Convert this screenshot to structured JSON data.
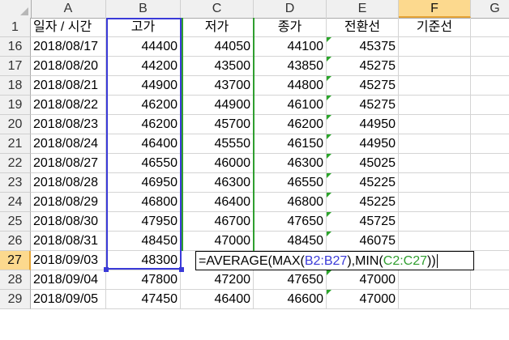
{
  "columns": [
    "A",
    "B",
    "C",
    "D",
    "E",
    "F",
    "G"
  ],
  "header_row": {
    "row": "1",
    "cells": [
      "일자 / 시간",
      "고가",
      "저가",
      "종가",
      "전환선",
      "기준선"
    ]
  },
  "rows": [
    {
      "row": "16",
      "date": "2018/08/17",
      "high": "44400",
      "low": "44050",
      "close": "44100",
      "conv": "45375"
    },
    {
      "row": "17",
      "date": "2018/08/20",
      "high": "44200",
      "low": "43500",
      "close": "43850",
      "conv": "45275"
    },
    {
      "row": "18",
      "date": "2018/08/21",
      "high": "44900",
      "low": "43700",
      "close": "44800",
      "conv": "45275"
    },
    {
      "row": "19",
      "date": "2018/08/22",
      "high": "46200",
      "low": "44900",
      "close": "46100",
      "conv": "45275"
    },
    {
      "row": "20",
      "date": "2018/08/23",
      "high": "46200",
      "low": "45700",
      "close": "46200",
      "conv": "44950"
    },
    {
      "row": "21",
      "date": "2018/08/24",
      "high": "46400",
      "low": "45550",
      "close": "46150",
      "conv": "44950"
    },
    {
      "row": "22",
      "date": "2018/08/27",
      "high": "46550",
      "low": "46000",
      "close": "46300",
      "conv": "45025"
    },
    {
      "row": "23",
      "date": "2018/08/28",
      "high": "46950",
      "low": "46300",
      "close": "46550",
      "conv": "45225"
    },
    {
      "row": "24",
      "date": "2018/08/29",
      "high": "46800",
      "low": "46400",
      "close": "46800",
      "conv": "45225"
    },
    {
      "row": "25",
      "date": "2018/08/30",
      "high": "47950",
      "low": "46700",
      "close": "47650",
      "conv": "45725"
    },
    {
      "row": "26",
      "date": "2018/08/31",
      "high": "48450",
      "low": "47000",
      "close": "48450",
      "conv": "46075"
    }
  ],
  "active_row": {
    "row": "27",
    "date": "2018/09/03",
    "high": "48300"
  },
  "formula": {
    "prefix": "=AVERAGE(MAX(",
    "ref_b": "B2:B27",
    "mid": "),MIN(",
    "ref_c": "C2:C27",
    "suffix": "))"
  },
  "after_rows": [
    {
      "row": "28",
      "date": "2018/09/04",
      "high": "47800",
      "low": "47200",
      "close": "47650",
      "conv": "47000"
    },
    {
      "row": "29",
      "date": "2018/09/05",
      "high": "47450",
      "low": "46400",
      "close": "46600",
      "conv": "47000"
    }
  ],
  "colors": {
    "range_b": "#3a3ad8",
    "range_c": "#2f9e2f",
    "active_header": "#fcd98e"
  }
}
